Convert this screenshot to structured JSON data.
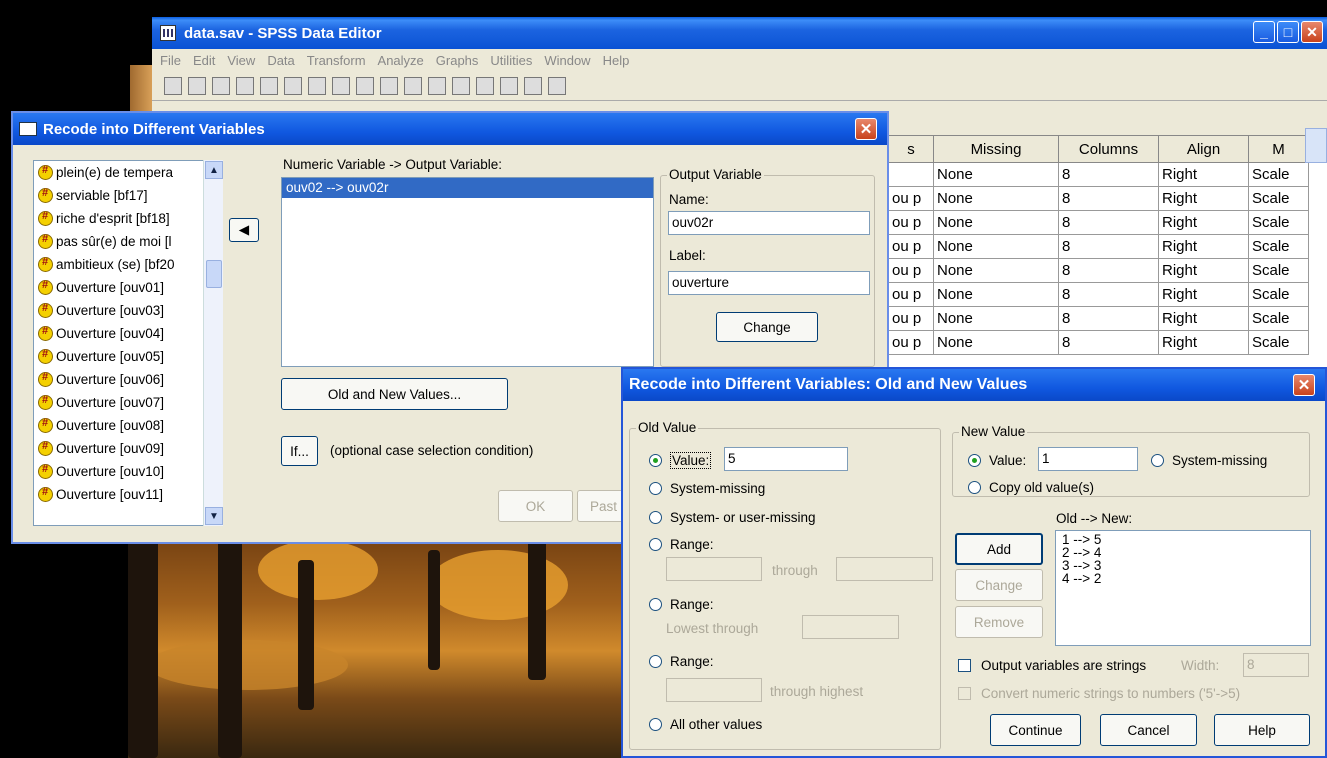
{
  "spss": {
    "title": "data.sav - SPSS Data Editor",
    "menu": [
      "File",
      "Edit",
      "View",
      "Data",
      "Transform",
      "Analyze",
      "Graphs",
      "Utilities",
      "Window",
      "Help"
    ],
    "grid_headers": [
      "s",
      "Missing",
      "Columns",
      "Align",
      "M"
    ],
    "grid_rows": [
      [
        "",
        "None",
        "8",
        "Right",
        "Scale"
      ],
      [
        "ou p",
        "None",
        "8",
        "Right",
        "Scale"
      ],
      [
        "ou p",
        "None",
        "8",
        "Right",
        "Scale"
      ],
      [
        "ou p",
        "None",
        "8",
        "Right",
        "Scale"
      ],
      [
        "ou p",
        "None",
        "8",
        "Right",
        "Scale"
      ],
      [
        "ou p",
        "None",
        "8",
        "Right",
        "Scale"
      ],
      [
        "ou p",
        "None",
        "8",
        "Right",
        "Scale"
      ],
      [
        "ou p",
        "None",
        "8",
        "Right",
        "Scale"
      ]
    ]
  },
  "recode": {
    "title": "Recode into Different Variables",
    "variables": [
      "plein(e) de tempera",
      "serviable [bf17]",
      "riche d'esprit [bf18]",
      "pas sûr(e) de moi [l",
      "ambitieux (se) [bf20",
      "Ouverture [ouv01]",
      "Ouverture [ouv03]",
      "Ouverture [ouv04]",
      "Ouverture [ouv05]",
      "Ouverture [ouv06]",
      "Ouverture [ouv07]",
      "Ouverture [ouv08]",
      "Ouverture [ouv09]",
      "Ouverture [ouv10]",
      "Ouverture [ouv11]"
    ],
    "numeric_label": "Numeric Variable -> Output Variable:",
    "mapping": "ouv02 --> ouv02r",
    "output_group": "Output Variable",
    "name_label": "Name:",
    "name_value": "ouv02r",
    "label_label": "Label:",
    "label_value": "ouverture",
    "change": "Change",
    "old_new": "Old and New Values...",
    "if_btn": "If...",
    "if_text": "(optional case selection condition)",
    "ok": "OK",
    "paste": "Past"
  },
  "oldnew": {
    "title": "Recode into Different Variables: Old and New Values",
    "old_group": "Old Value",
    "value_label": "Value:",
    "value": "5",
    "system_missing": "System-missing",
    "sys_user_missing": "System- or user-missing",
    "range": "Range:",
    "through": "through",
    "lowest_through": "Lowest through",
    "through_highest": "through highest",
    "all_other": "All other values",
    "new_group": "New Value",
    "new_value": "1",
    "new_sys_missing": "System-missing",
    "copy_old": "Copy old value(s)",
    "old_new_label": "Old --> New:",
    "pairs": [
      "1 --> 5",
      "2 --> 4",
      "3 --> 3",
      "4 --> 2"
    ],
    "add": "Add",
    "change": "Change",
    "remove": "Remove",
    "output_strings": "Output variables are strings",
    "width_label": "Width:",
    "width_value": "8",
    "convert": "Convert numeric strings to numbers ('5'->5)",
    "continue": "Continue",
    "cancel": "Cancel",
    "help": "Help"
  }
}
